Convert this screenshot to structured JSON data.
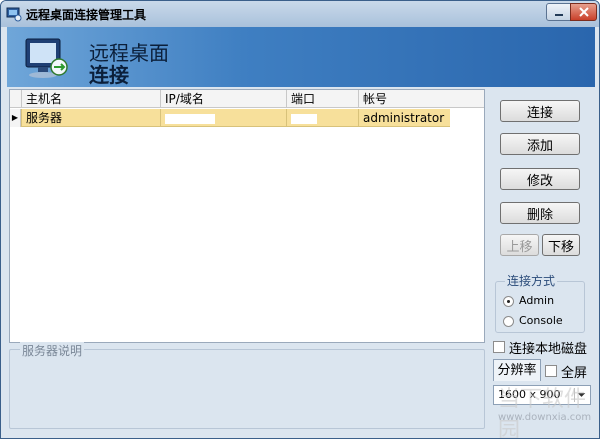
{
  "window": {
    "title": "远程桌面连接管理工具"
  },
  "banner": {
    "line1": "远程桌面",
    "line2": "连接"
  },
  "grid": {
    "columns": [
      "主机名",
      "IP/域名",
      "端口",
      "帐号"
    ],
    "rows": [
      {
        "host": "服务器",
        "ip": "",
        "port": "",
        "account": "administrator",
        "selected": true
      }
    ]
  },
  "description": {
    "label": "服务器说明"
  },
  "actions": {
    "connect": "连接",
    "add": "添加",
    "edit": "修改",
    "delete": "删除",
    "move_up": "上移",
    "move_down": "下移"
  },
  "connection_mode": {
    "label": "连接方式",
    "options": [
      "Admin",
      "Console"
    ],
    "selected": "Admin"
  },
  "options": {
    "local_disk": "连接本地磁盘",
    "resolution_tab": "分辨率",
    "fullscreen": "全屏",
    "resolution_value": "1600 x 900"
  },
  "watermark": {
    "text": "当下软件园",
    "url": "www.downxia.com"
  }
}
